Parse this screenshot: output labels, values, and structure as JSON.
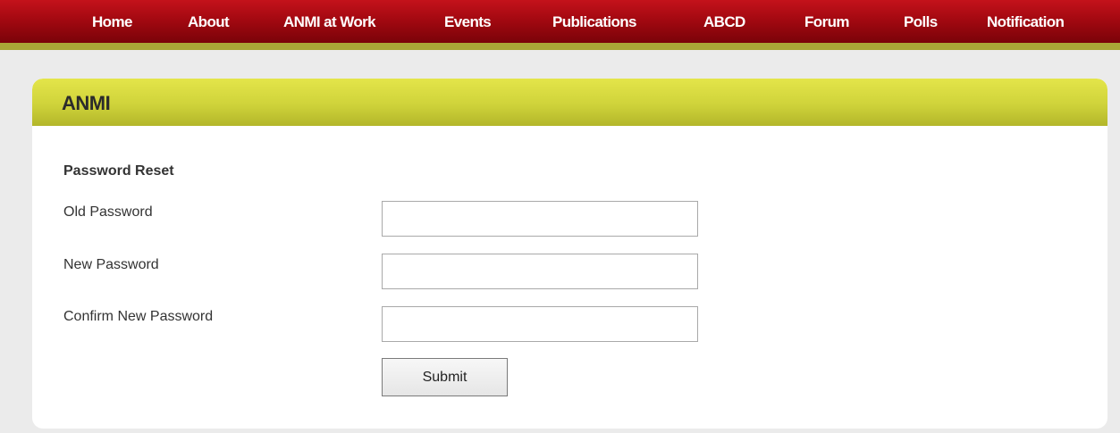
{
  "nav": {
    "items": [
      {
        "label": "Home"
      },
      {
        "label": "About"
      },
      {
        "label": "ANMI at Work"
      },
      {
        "label": "Events"
      },
      {
        "label": "Publications"
      },
      {
        "label": "ABCD"
      },
      {
        "label": "Forum"
      },
      {
        "label": "Polls"
      },
      {
        "label": "Notification"
      }
    ]
  },
  "panel": {
    "title": "ANMI"
  },
  "form": {
    "section_title": "Password Reset",
    "fields": [
      {
        "label": "Old Password",
        "value": ""
      },
      {
        "label": "New Password",
        "value": ""
      },
      {
        "label": "Confirm New Password",
        "value": ""
      }
    ],
    "submit_label": "Submit"
  },
  "colors": {
    "nav_red": "#a00810",
    "olive_bar": "#a9a737",
    "header_yellow": "#cfd33a",
    "page_bg": "#ebebeb"
  }
}
